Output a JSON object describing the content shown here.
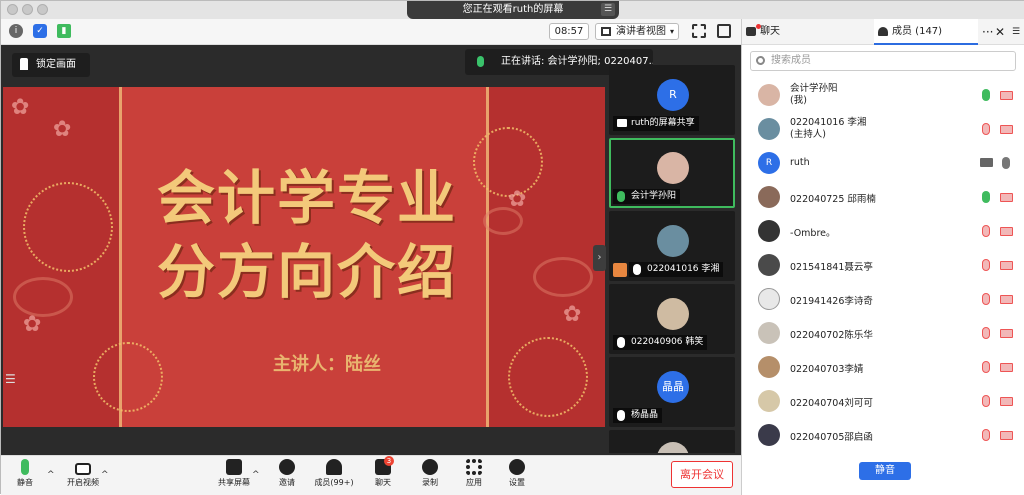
{
  "banner": {
    "viewing": "您正在观看ruth的屏幕"
  },
  "toolbar": {
    "time": "08:57",
    "view_mode": "演讲者视图"
  },
  "stage": {
    "lock_label": "锁定画面",
    "speaking": "正在讲话: 会计学孙阳; 0220407..."
  },
  "slide": {
    "title_line1": "会计学专业",
    "title_line2": "分方向介绍",
    "presenter": "主讲人：陆丝"
  },
  "thumbnails": [
    {
      "avatar": "R",
      "name": "ruth的屏幕共享"
    },
    {
      "avatar": "",
      "name": "会计学孙阳"
    },
    {
      "avatar": "",
      "name": "022041016 李湘"
    },
    {
      "avatar": "",
      "name": "022040906 韩笑"
    },
    {
      "avatar": "晶晶",
      "name": "杨晶晶"
    }
  ],
  "bottombar": {
    "mute": "静音",
    "video": "开启视频",
    "share": "共享屏幕",
    "invite": "邀请",
    "members": "成员(99+)",
    "chat": "聊天",
    "chat_badge": "3",
    "record": "录制",
    "apps": "应用",
    "settings": "设置",
    "leave": "离开会议"
  },
  "panel": {
    "tab_chat": "聊天",
    "tab_members": "成员 (147)",
    "search_placeholder": "搜索成员",
    "mute_button": "静音",
    "members": [
      {
        "name": "会计学孙阳",
        "sub": "(我)"
      },
      {
        "name": "022041016 李湘",
        "sub": "(主持人)"
      },
      {
        "name": "ruth",
        "avatar": "R"
      },
      {
        "name": "022040725 邱雨楠"
      },
      {
        "name": "-Ombre。"
      },
      {
        "name": "021541841聂云亭"
      },
      {
        "name": "021941426李诗奇"
      },
      {
        "name": "022040702陈乐华"
      },
      {
        "name": "022040703李婧"
      },
      {
        "name": "022040704刘可可"
      },
      {
        "name": "022040705邵启函"
      }
    ]
  }
}
